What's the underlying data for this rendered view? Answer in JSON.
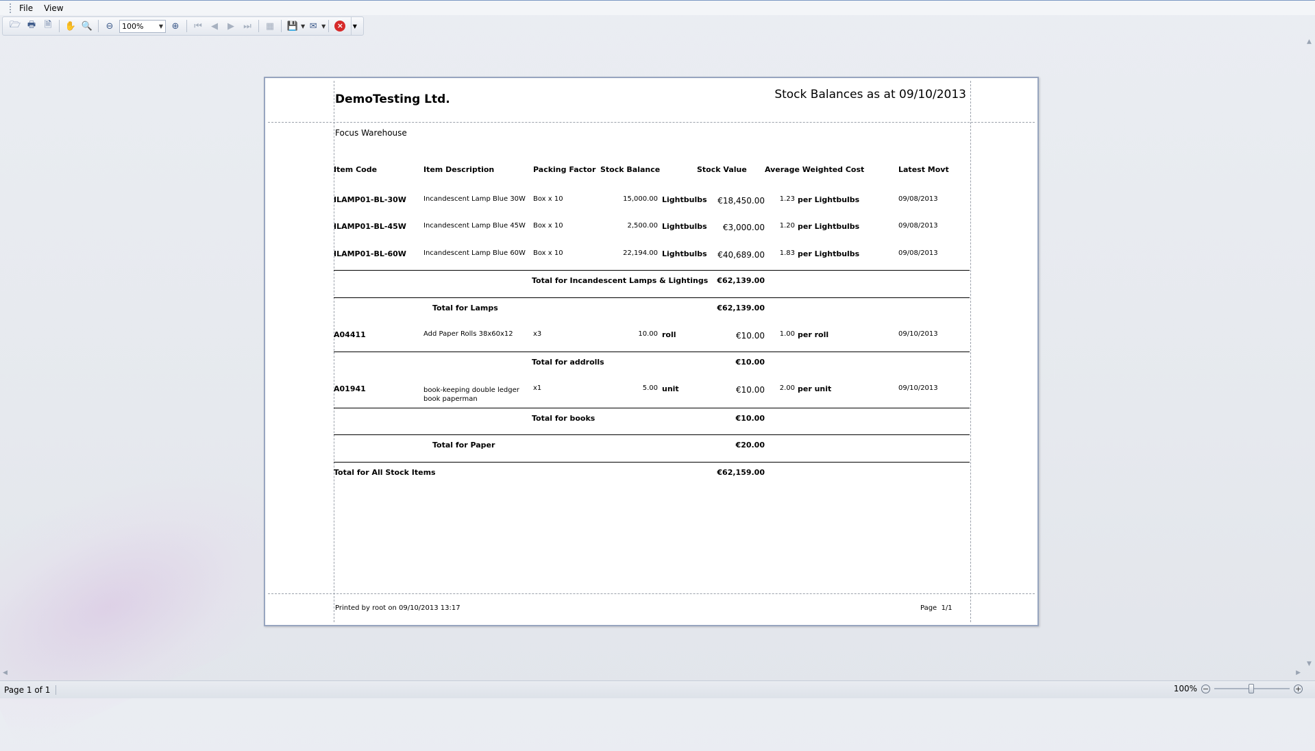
{
  "menu": {
    "file": "File",
    "view": "View"
  },
  "toolbar": {
    "zoom_value": "100%",
    "icons": [
      "open-icon",
      "print-icon",
      "page-setup-icon",
      "hand-icon",
      "magnifier-icon",
      "zoom-out-icon",
      "zoom-in-icon",
      "first-page-icon",
      "prev-page-icon",
      "next-page-icon",
      "last-page-icon",
      "multi-page-icon",
      "export-icon",
      "email-icon",
      "close-preview-icon"
    ]
  },
  "report": {
    "company": "DemoTesting Ltd.",
    "title": "Stock Balances as at 09/10/2013",
    "warehouse": "Focus Warehouse",
    "columns": {
      "item_code": "Item Code",
      "item_description": "Item Description",
      "packing_factor": "Packing Factor",
      "stock_balance": "Stock Balance",
      "stock_value": "Stock Value",
      "avg_weighted_cost": "Average Weighted Cost",
      "latest_movt": "Latest Movt"
    },
    "rows": [
      {
        "code": "ILAMP01-BL-30W",
        "desc": "Incandescent Lamp Blue 30W",
        "pack": "Box x 10",
        "balance": "15,000.00",
        "unit": "Lightbulbs",
        "value": "€18,450.00",
        "cost": "1.23",
        "per": "per Lightbulbs",
        "movt": "09/08/2013"
      },
      {
        "code": "ILAMP01-BL-45W",
        "desc": "Incandescent Lamp Blue 45W",
        "pack": "Box x 10",
        "balance": "2,500.00",
        "unit": "Lightbulbs",
        "value": "€3,000.00",
        "cost": "1.20",
        "per": "per Lightbulbs",
        "movt": "09/08/2013"
      },
      {
        "code": "ILAMP01-BL-60W",
        "desc": "Incandescent Lamp Blue 60W",
        "pack": "Box x 10",
        "balance": "22,194.00",
        "unit": "Lightbulbs",
        "value": "€40,689.00",
        "cost": "1.83",
        "per": "per Lightbulbs",
        "movt": "09/08/2013"
      },
      {
        "code": "A04411",
        "desc": "Add Paper Rolls 38x60x12",
        "pack": "x3",
        "balance": "10.00",
        "unit": "roll",
        "value": "€10.00",
        "cost": "1.00",
        "per": "per roll",
        "movt": "09/10/2013"
      },
      {
        "code": "A01941",
        "desc": "book-keeping double ledger book paperman",
        "pack": "x1",
        "balance": "5.00",
        "unit": "unit",
        "value": "€10.00",
        "cost": "2.00",
        "per": "per unit",
        "movt": "09/10/2013"
      }
    ],
    "totals": {
      "incandescent_label": "Total for Incandescent Lamps & Lightings",
      "incandescent_value": "€62,139.00",
      "lamps_label": "Total for Lamps",
      "lamps_value": "€62,139.00",
      "addrolls_label": "Total for addrolls",
      "addrolls_value": "€10.00",
      "books_label": "Total for books",
      "books_value": "€10.00",
      "paper_label": "Total for Paper",
      "paper_value": "€20.00",
      "all_label": "Total for All Stock Items",
      "all_value": "€62,159.00"
    },
    "footer": {
      "printed": "Printed by root on 09/10/2013 13:17",
      "page": "Page  1/1"
    }
  },
  "status": {
    "page": "Page 1 of 1",
    "zoom": "100%"
  }
}
